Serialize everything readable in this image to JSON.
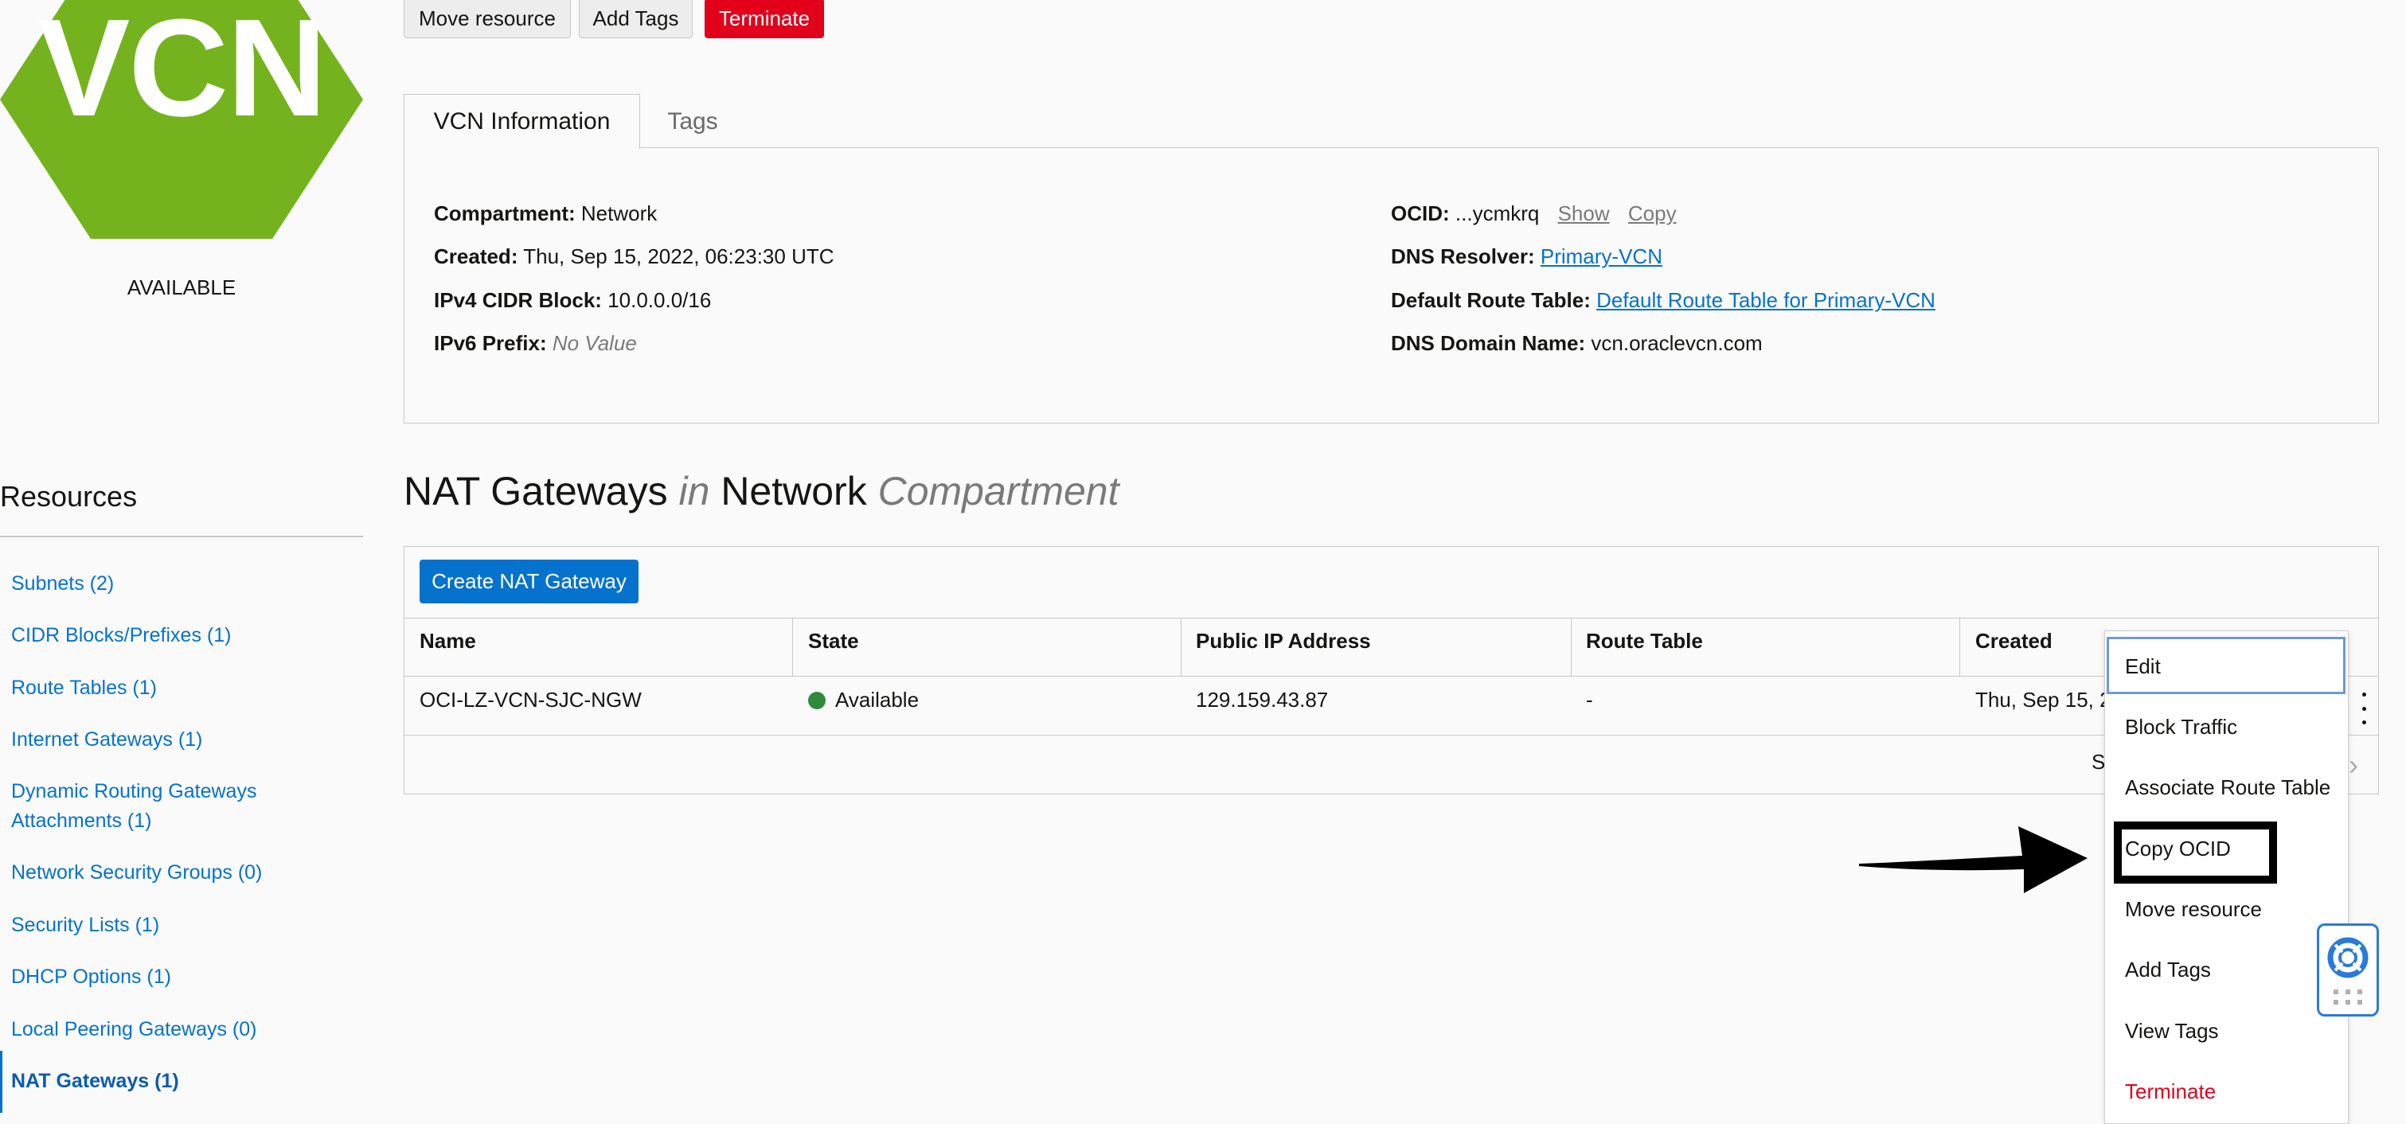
{
  "badge": {
    "text": "VCN",
    "status": "AVAILABLE",
    "color": "#74b31d"
  },
  "toolbar": {
    "move_label": "Move resource",
    "add_tags_label": "Add Tags",
    "terminate_label": "Terminate"
  },
  "tabs": {
    "info_label": "VCN Information",
    "tags_label": "Tags"
  },
  "info": {
    "compartment_label": "Compartment:",
    "compartment_value": "Network",
    "created_label": "Created:",
    "created_value": "Thu, Sep 15, 2022, 06:23:30 UTC",
    "ipv4_label": "IPv4 CIDR Block:",
    "ipv4_value": "10.0.0.0/16",
    "ipv6_label": "IPv6 Prefix:",
    "ipv6_value": "No Value",
    "ocid_label": "OCID:",
    "ocid_value": "...ycmkrq",
    "ocid_show": "Show",
    "ocid_copy": "Copy",
    "dns_resolver_label": "DNS Resolver:",
    "dns_resolver_value": "Primary-VCN",
    "route_table_label": "Default Route Table:",
    "route_table_value": "Default Route Table for Primary-VCN",
    "dns_domain_label": "DNS Domain Name:",
    "dns_domain_value": "vcn.oraclevcn.com"
  },
  "resources": {
    "title": "Resources",
    "items": [
      "Subnets (2)",
      "CIDR Blocks/Prefixes (1)",
      "Route Tables (1)",
      "Internet Gateways (1)",
      "Dynamic Routing Gateways",
      "Attachments (1)",
      "Network Security Groups (0)",
      "Security Lists (1)",
      "DHCP Options (1)",
      "Local Peering Gateways (0)",
      "NAT Gateways (1)"
    ]
  },
  "heading": {
    "part1": "NAT Gateways",
    "in": "in",
    "part2": "Network",
    "part3": "Compartment"
  },
  "table": {
    "create_label": "Create NAT Gateway",
    "columns": [
      "Name",
      "State",
      "Public IP Address",
      "Route Table",
      "Created"
    ],
    "row": {
      "name": "OCI-LZ-VCN-SJC-NGW",
      "state": "Available",
      "ip": "129.159.43.87",
      "route": "-",
      "created": "Thu, Sep 15, 2"
    },
    "footer_partial": "S",
    "state_color": "#2e8b3a"
  },
  "menu": {
    "items": [
      "Edit",
      "Block Traffic",
      "Associate Route Table",
      "Copy OCID",
      "Move resource",
      "Add Tags",
      "View Tags",
      "Terminate"
    ]
  }
}
